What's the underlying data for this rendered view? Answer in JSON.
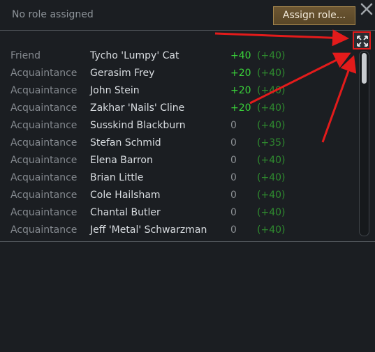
{
  "header": {
    "role_text": "No role assigned",
    "assign_label": "Assign role..."
  },
  "relations": [
    {
      "relation": "Friend",
      "name": "Tycho 'Lumpy' Cat",
      "opinion": "+40",
      "cap": "(+40)"
    },
    {
      "relation": "Acquaintance",
      "name": "Gerasim Frey",
      "opinion": "+20",
      "cap": "(+40)"
    },
    {
      "relation": "Acquaintance",
      "name": "John Stein",
      "opinion": "+20",
      "cap": "(+40)"
    },
    {
      "relation": "Acquaintance",
      "name": "Zakhar 'Nails' Cline",
      "opinion": "+20",
      "cap": "(+40)"
    },
    {
      "relation": "Acquaintance",
      "name": "Susskind Blackburn",
      "opinion": "0",
      "cap": "(+40)"
    },
    {
      "relation": "Acquaintance",
      "name": "Stefan Schmid",
      "opinion": "0",
      "cap": "(+35)"
    },
    {
      "relation": "Acquaintance",
      "name": "Elena Barron",
      "opinion": "0",
      "cap": "(+40)"
    },
    {
      "relation": "Acquaintance",
      "name": "Brian Little",
      "opinion": "0",
      "cap": "(+40)"
    },
    {
      "relation": "Acquaintance",
      "name": "Cole Hailsham",
      "opinion": "0",
      "cap": "(+40)"
    },
    {
      "relation": "Acquaintance",
      "name": "Chantal Butler",
      "opinion": "0",
      "cap": "(+40)"
    },
    {
      "relation": "Acquaintance",
      "name": "Jeff 'Metal' Schwarzman",
      "opinion": "0",
      "cap": "(+40)"
    }
  ],
  "scrollbar": {
    "visible_fraction": 0.17
  },
  "icons": {
    "close": "close-icon",
    "expand": "expand-icon"
  },
  "colors": {
    "background": "#1b1e22",
    "positive_opinion": "#3ad13a",
    "cap_green": "#2f8b2f",
    "annotation_red": "#e31b1b",
    "button_gold": "#6c5632"
  }
}
